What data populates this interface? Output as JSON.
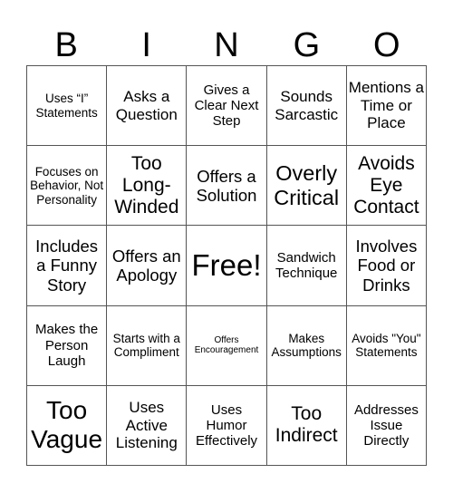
{
  "header": {
    "letters": [
      "B",
      "I",
      "N",
      "G",
      "O"
    ]
  },
  "cells": [
    [
      "Uses “I” Statements",
      "Asks a Question",
      "Gives a Clear Next Step",
      "Sounds Sarcastic",
      "Mentions a Time or Place"
    ],
    [
      "Focuses on Behavior, Not Personality",
      "Too Long-Winded",
      "Offers a Solution",
      "Overly Critical",
      "Avoids Eye Contact"
    ],
    [
      "Includes a Funny Story",
      "Offers an Apology",
      "Free!",
      "Sandwich Technique",
      "Involves Food or Drinks"
    ],
    [
      "Makes the Person Laugh",
      "Starts with a Compliment",
      "Offers Encouragement",
      "Makes Assumptions",
      "Avoids \"You\" Statements"
    ],
    [
      "Too Vague",
      "Uses Active Listening",
      "Uses Humor Effectively",
      "Too Indirect",
      "Addresses Issue Directly"
    ]
  ]
}
